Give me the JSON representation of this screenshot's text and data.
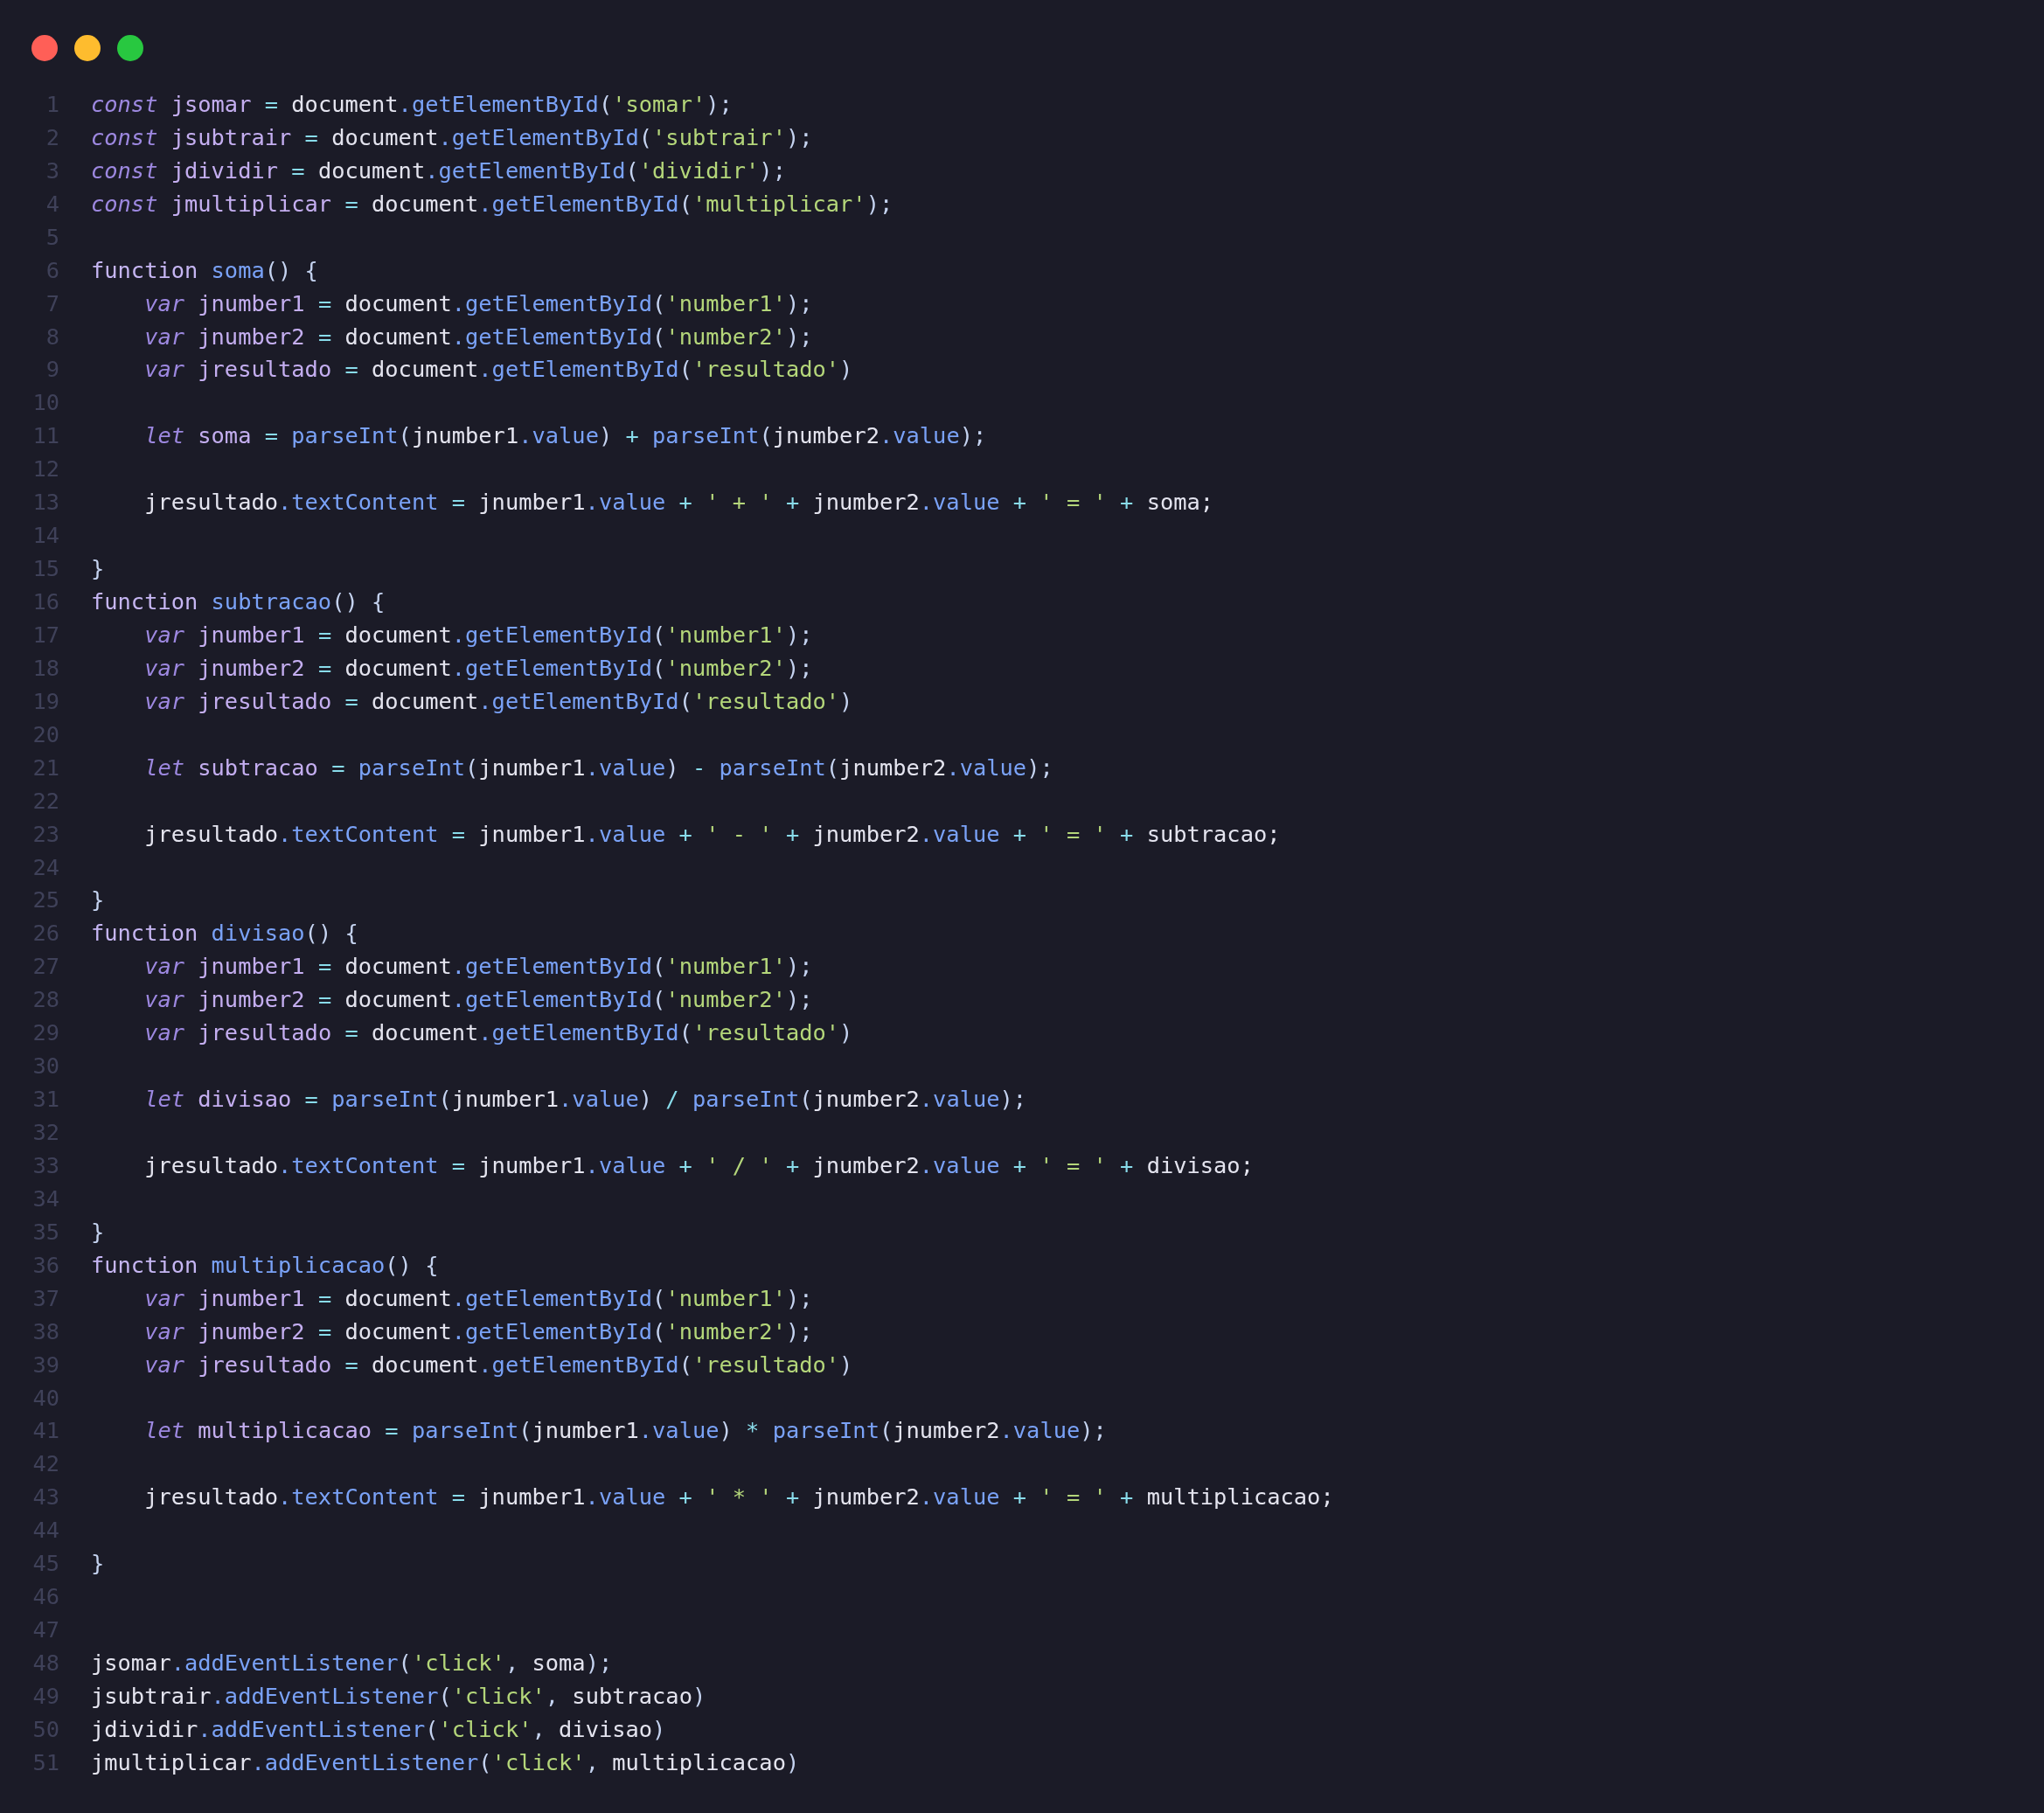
{
  "window": {
    "controls": [
      {
        "kind": "close"
      },
      {
        "kind": "minimize"
      },
      {
        "kind": "zoom"
      }
    ]
  },
  "code": {
    "lines": [
      {
        "number": "1",
        "tokens": [
          {
            "kind": "kw",
            "text": "const"
          },
          {
            "kind": "def",
            "text": " jsomar"
          },
          {
            "kind": "op",
            "text": " = "
          },
          {
            "kind": "id",
            "text": "document"
          },
          {
            "kind": "prop",
            "text": ".getElementById"
          },
          {
            "kind": "p",
            "text": "("
          },
          {
            "kind": "str",
            "text": "'somar'"
          },
          {
            "kind": "p",
            "text": ");"
          }
        ]
      },
      {
        "number": "2",
        "tokens": [
          {
            "kind": "kw",
            "text": "const"
          },
          {
            "kind": "def",
            "text": " jsubtrair"
          },
          {
            "kind": "op",
            "text": " = "
          },
          {
            "kind": "id",
            "text": "document"
          },
          {
            "kind": "prop",
            "text": ".getElementById"
          },
          {
            "kind": "p",
            "text": "("
          },
          {
            "kind": "str",
            "text": "'subtrair'"
          },
          {
            "kind": "p",
            "text": ");"
          }
        ]
      },
      {
        "number": "3",
        "tokens": [
          {
            "kind": "kw",
            "text": "const"
          },
          {
            "kind": "def",
            "text": " jdividir"
          },
          {
            "kind": "op",
            "text": " = "
          },
          {
            "kind": "id",
            "text": "document"
          },
          {
            "kind": "prop",
            "text": ".getElementById"
          },
          {
            "kind": "p",
            "text": "("
          },
          {
            "kind": "str",
            "text": "'dividir'"
          },
          {
            "kind": "p",
            "text": ");"
          }
        ]
      },
      {
        "number": "4",
        "tokens": [
          {
            "kind": "kw",
            "text": "const"
          },
          {
            "kind": "def",
            "text": " jmultiplicar"
          },
          {
            "kind": "op",
            "text": " = "
          },
          {
            "kind": "id",
            "text": "document"
          },
          {
            "kind": "prop",
            "text": ".getElementById"
          },
          {
            "kind": "p",
            "text": "("
          },
          {
            "kind": "str",
            "text": "'multiplicar'"
          },
          {
            "kind": "p",
            "text": ");"
          }
        ]
      },
      {
        "number": "5"
      },
      {
        "number": "6",
        "tokens": [
          {
            "kind": "fn",
            "text": "function"
          },
          {
            "kind": "prop",
            "text": " soma"
          },
          {
            "kind": "p",
            "text": "() {"
          }
        ]
      },
      {
        "number": "7",
        "tokens": [
          {
            "kind": "kw",
            "text": "    var"
          },
          {
            "kind": "def",
            "text": " jnumber1"
          },
          {
            "kind": "op",
            "text": " = "
          },
          {
            "kind": "id",
            "text": "document"
          },
          {
            "kind": "prop",
            "text": ".getElementById"
          },
          {
            "kind": "p",
            "text": "("
          },
          {
            "kind": "str",
            "text": "'number1'"
          },
          {
            "kind": "p",
            "text": ");"
          }
        ]
      },
      {
        "number": "8",
        "tokens": [
          {
            "kind": "kw",
            "text": "    var"
          },
          {
            "kind": "def",
            "text": " jnumber2"
          },
          {
            "kind": "op",
            "text": " = "
          },
          {
            "kind": "id",
            "text": "document"
          },
          {
            "kind": "prop",
            "text": ".getElementById"
          },
          {
            "kind": "p",
            "text": "("
          },
          {
            "kind": "str",
            "text": "'number2'"
          },
          {
            "kind": "p",
            "text": ");"
          }
        ]
      },
      {
        "number": "9",
        "tokens": [
          {
            "kind": "kw",
            "text": "    var"
          },
          {
            "kind": "def",
            "text": " jresultado"
          },
          {
            "kind": "op",
            "text": " = "
          },
          {
            "kind": "id",
            "text": "document"
          },
          {
            "kind": "prop",
            "text": ".getElementById"
          },
          {
            "kind": "p",
            "text": "("
          },
          {
            "kind": "str",
            "text": "'resultado'"
          },
          {
            "kind": "p",
            "text": ")"
          }
        ]
      },
      {
        "number": "10"
      },
      {
        "number": "11",
        "tokens": [
          {
            "kind": "kw",
            "text": "    let"
          },
          {
            "kind": "def",
            "text": " soma"
          },
          {
            "kind": "op",
            "text": " = "
          },
          {
            "kind": "prop",
            "text": "parseInt"
          },
          {
            "kind": "p",
            "text": "("
          },
          {
            "kind": "id",
            "text": "jnumber1"
          },
          {
            "kind": "prop",
            "text": ".value"
          },
          {
            "kind": "p",
            "text": ")"
          },
          {
            "kind": "op",
            "text": " + "
          },
          {
            "kind": "prop",
            "text": "parseInt"
          },
          {
            "kind": "p",
            "text": "("
          },
          {
            "kind": "id",
            "text": "jnumber2"
          },
          {
            "kind": "prop",
            "text": ".value"
          },
          {
            "kind": "p",
            "text": ");"
          }
        ]
      },
      {
        "number": "12"
      },
      {
        "number": "13",
        "tokens": [
          {
            "kind": "id",
            "text": "    jresultado"
          },
          {
            "kind": "prop",
            "text": ".textContent"
          },
          {
            "kind": "op",
            "text": " = "
          },
          {
            "kind": "id",
            "text": "jnumber1"
          },
          {
            "kind": "prop",
            "text": ".value"
          },
          {
            "kind": "op",
            "text": " + "
          },
          {
            "kind": "str",
            "text": "' + '"
          },
          {
            "kind": "op",
            "text": " + "
          },
          {
            "kind": "id",
            "text": "jnumber2"
          },
          {
            "kind": "prop",
            "text": ".value"
          },
          {
            "kind": "op",
            "text": " + "
          },
          {
            "kind": "str",
            "text": "' = '"
          },
          {
            "kind": "op",
            "text": " + "
          },
          {
            "kind": "id",
            "text": "soma;"
          }
        ]
      },
      {
        "number": "14"
      },
      {
        "number": "15",
        "tokens": [
          {
            "kind": "p",
            "text": "}"
          }
        ]
      },
      {
        "number": "16",
        "tokens": [
          {
            "kind": "fn",
            "text": "function"
          },
          {
            "kind": "prop",
            "text": " subtracao"
          },
          {
            "kind": "p",
            "text": "() {"
          }
        ]
      },
      {
        "number": "17",
        "tokens": [
          {
            "kind": "kw",
            "text": "    var"
          },
          {
            "kind": "def",
            "text": " jnumber1"
          },
          {
            "kind": "op",
            "text": " = "
          },
          {
            "kind": "id",
            "text": "document"
          },
          {
            "kind": "prop",
            "text": ".getElementById"
          },
          {
            "kind": "p",
            "text": "("
          },
          {
            "kind": "str",
            "text": "'number1'"
          },
          {
            "kind": "p",
            "text": ");"
          }
        ]
      },
      {
        "number": "18",
        "tokens": [
          {
            "kind": "kw",
            "text": "    var"
          },
          {
            "kind": "def",
            "text": " jnumber2"
          },
          {
            "kind": "op",
            "text": " = "
          },
          {
            "kind": "id",
            "text": "document"
          },
          {
            "kind": "prop",
            "text": ".getElementById"
          },
          {
            "kind": "p",
            "text": "("
          },
          {
            "kind": "str",
            "text": "'number2'"
          },
          {
            "kind": "p",
            "text": ");"
          }
        ]
      },
      {
        "number": "19",
        "tokens": [
          {
            "kind": "kw",
            "text": "    var"
          },
          {
            "kind": "def",
            "text": " jresultado"
          },
          {
            "kind": "op",
            "text": " = "
          },
          {
            "kind": "id",
            "text": "document"
          },
          {
            "kind": "prop",
            "text": ".getElementById"
          },
          {
            "kind": "p",
            "text": "("
          },
          {
            "kind": "str",
            "text": "'resultado'"
          },
          {
            "kind": "p",
            "text": ")"
          }
        ]
      },
      {
        "number": "20"
      },
      {
        "number": "21",
        "tokens": [
          {
            "kind": "kw",
            "text": "    let"
          },
          {
            "kind": "def",
            "text": " subtracao"
          },
          {
            "kind": "op",
            "text": " = "
          },
          {
            "kind": "prop",
            "text": "parseInt"
          },
          {
            "kind": "p",
            "text": "("
          },
          {
            "kind": "id",
            "text": "jnumber1"
          },
          {
            "kind": "prop",
            "text": ".value"
          },
          {
            "kind": "p",
            "text": ")"
          },
          {
            "kind": "op",
            "text": " - "
          },
          {
            "kind": "prop",
            "text": "parseInt"
          },
          {
            "kind": "p",
            "text": "("
          },
          {
            "kind": "id",
            "text": "jnumber2"
          },
          {
            "kind": "prop",
            "text": ".value"
          },
          {
            "kind": "p",
            "text": ");"
          }
        ]
      },
      {
        "number": "22"
      },
      {
        "number": "23",
        "tokens": [
          {
            "kind": "id",
            "text": "    jresultado"
          },
          {
            "kind": "prop",
            "text": ".textContent"
          },
          {
            "kind": "op",
            "text": " = "
          },
          {
            "kind": "id",
            "text": "jnumber1"
          },
          {
            "kind": "prop",
            "text": ".value"
          },
          {
            "kind": "op",
            "text": " + "
          },
          {
            "kind": "str",
            "text": "' - '"
          },
          {
            "kind": "op",
            "text": " + "
          },
          {
            "kind": "id",
            "text": "jnumber2"
          },
          {
            "kind": "prop",
            "text": ".value"
          },
          {
            "kind": "op",
            "text": " + "
          },
          {
            "kind": "str",
            "text": "' = '"
          },
          {
            "kind": "op",
            "text": " + "
          },
          {
            "kind": "id",
            "text": "subtracao;"
          }
        ]
      },
      {
        "number": "24"
      },
      {
        "number": "25",
        "tokens": [
          {
            "kind": "p",
            "text": "}"
          }
        ]
      },
      {
        "number": "26",
        "tokens": [
          {
            "kind": "fn",
            "text": "function"
          },
          {
            "kind": "prop",
            "text": " divisao"
          },
          {
            "kind": "p",
            "text": "() {"
          }
        ]
      },
      {
        "number": "27",
        "tokens": [
          {
            "kind": "kw",
            "text": "    var"
          },
          {
            "kind": "def",
            "text": " jnumber1"
          },
          {
            "kind": "op",
            "text": " = "
          },
          {
            "kind": "id",
            "text": "document"
          },
          {
            "kind": "prop",
            "text": ".getElementById"
          },
          {
            "kind": "p",
            "text": "("
          },
          {
            "kind": "str",
            "text": "'number1'"
          },
          {
            "kind": "p",
            "text": ");"
          }
        ]
      },
      {
        "number": "28",
        "tokens": [
          {
            "kind": "kw",
            "text": "    var"
          },
          {
            "kind": "def",
            "text": " jnumber2"
          },
          {
            "kind": "op",
            "text": " = "
          },
          {
            "kind": "id",
            "text": "document"
          },
          {
            "kind": "prop",
            "text": ".getElementById"
          },
          {
            "kind": "p",
            "text": "("
          },
          {
            "kind": "str",
            "text": "'number2'"
          },
          {
            "kind": "p",
            "text": ");"
          }
        ]
      },
      {
        "number": "29",
        "tokens": [
          {
            "kind": "kw",
            "text": "    var"
          },
          {
            "kind": "def",
            "text": " jresultado"
          },
          {
            "kind": "op",
            "text": " = "
          },
          {
            "kind": "id",
            "text": "document"
          },
          {
            "kind": "prop",
            "text": ".getElementById"
          },
          {
            "kind": "p",
            "text": "("
          },
          {
            "kind": "str",
            "text": "'resultado'"
          },
          {
            "kind": "p",
            "text": ")"
          }
        ]
      },
      {
        "number": "30"
      },
      {
        "number": "31",
        "tokens": [
          {
            "kind": "kw",
            "text": "    let"
          },
          {
            "kind": "def",
            "text": " divisao"
          },
          {
            "kind": "op",
            "text": " = "
          },
          {
            "kind": "prop",
            "text": "parseInt"
          },
          {
            "kind": "p",
            "text": "("
          },
          {
            "kind": "id",
            "text": "jnumber1"
          },
          {
            "kind": "prop",
            "text": ".value"
          },
          {
            "kind": "p",
            "text": ")"
          },
          {
            "kind": "op",
            "text": " / "
          },
          {
            "kind": "prop",
            "text": "parseInt"
          },
          {
            "kind": "p",
            "text": "("
          },
          {
            "kind": "id",
            "text": "jnumber2"
          },
          {
            "kind": "prop",
            "text": ".value"
          },
          {
            "kind": "p",
            "text": ");"
          }
        ]
      },
      {
        "number": "32"
      },
      {
        "number": "33",
        "tokens": [
          {
            "kind": "id",
            "text": "    jresultado"
          },
          {
            "kind": "prop",
            "text": ".textContent"
          },
          {
            "kind": "op",
            "text": " = "
          },
          {
            "kind": "id",
            "text": "jnumber1"
          },
          {
            "kind": "prop",
            "text": ".value"
          },
          {
            "kind": "op",
            "text": " + "
          },
          {
            "kind": "str",
            "text": "' / '"
          },
          {
            "kind": "op",
            "text": " + "
          },
          {
            "kind": "id",
            "text": "jnumber2"
          },
          {
            "kind": "prop",
            "text": ".value"
          },
          {
            "kind": "op",
            "text": " + "
          },
          {
            "kind": "str",
            "text": "' = '"
          },
          {
            "kind": "op",
            "text": " + "
          },
          {
            "kind": "id",
            "text": "divisao;"
          }
        ]
      },
      {
        "number": "34"
      },
      {
        "number": "35",
        "tokens": [
          {
            "kind": "p",
            "text": "}"
          }
        ]
      },
      {
        "number": "36",
        "tokens": [
          {
            "kind": "fn",
            "text": "function"
          },
          {
            "kind": "prop",
            "text": " multiplicacao"
          },
          {
            "kind": "p",
            "text": "() {"
          }
        ]
      },
      {
        "number": "37",
        "tokens": [
          {
            "kind": "kw",
            "text": "    var"
          },
          {
            "kind": "def",
            "text": " jnumber1"
          },
          {
            "kind": "op",
            "text": " = "
          },
          {
            "kind": "id",
            "text": "document"
          },
          {
            "kind": "prop",
            "text": ".getElementById"
          },
          {
            "kind": "p",
            "text": "("
          },
          {
            "kind": "str",
            "text": "'number1'"
          },
          {
            "kind": "p",
            "text": ");"
          }
        ]
      },
      {
        "number": "38",
        "tokens": [
          {
            "kind": "kw",
            "text": "    var"
          },
          {
            "kind": "def",
            "text": " jnumber2"
          },
          {
            "kind": "op",
            "text": " = "
          },
          {
            "kind": "id",
            "text": "document"
          },
          {
            "kind": "prop",
            "text": ".getElementById"
          },
          {
            "kind": "p",
            "text": "("
          },
          {
            "kind": "str",
            "text": "'number2'"
          },
          {
            "kind": "p",
            "text": ");"
          }
        ]
      },
      {
        "number": "39",
        "tokens": [
          {
            "kind": "kw",
            "text": "    var"
          },
          {
            "kind": "def",
            "text": " jresultado"
          },
          {
            "kind": "op",
            "text": " = "
          },
          {
            "kind": "id",
            "text": "document"
          },
          {
            "kind": "prop",
            "text": ".getElementById"
          },
          {
            "kind": "p",
            "text": "("
          },
          {
            "kind": "str",
            "text": "'resultado'"
          },
          {
            "kind": "p",
            "text": ")"
          }
        ]
      },
      {
        "number": "40"
      },
      {
        "number": "41",
        "tokens": [
          {
            "kind": "kw",
            "text": "    let"
          },
          {
            "kind": "def",
            "text": " multiplicacao"
          },
          {
            "kind": "op",
            "text": " = "
          },
          {
            "kind": "prop",
            "text": "parseInt"
          },
          {
            "kind": "p",
            "text": "("
          },
          {
            "kind": "id",
            "text": "jnumber1"
          },
          {
            "kind": "prop",
            "text": ".value"
          },
          {
            "kind": "p",
            "text": ")"
          },
          {
            "kind": "op",
            "text": " * "
          },
          {
            "kind": "prop",
            "text": "parseInt"
          },
          {
            "kind": "p",
            "text": "("
          },
          {
            "kind": "id",
            "text": "jnumber2"
          },
          {
            "kind": "prop",
            "text": ".value"
          },
          {
            "kind": "p",
            "text": ");"
          }
        ]
      },
      {
        "number": "42"
      },
      {
        "number": "43",
        "tokens": [
          {
            "kind": "id",
            "text": "    jresultado"
          },
          {
            "kind": "prop",
            "text": ".textContent"
          },
          {
            "kind": "op",
            "text": " = "
          },
          {
            "kind": "id",
            "text": "jnumber1"
          },
          {
            "kind": "prop",
            "text": ".value"
          },
          {
            "kind": "op",
            "text": " + "
          },
          {
            "kind": "str",
            "text": "' * '"
          },
          {
            "kind": "op",
            "text": " + "
          },
          {
            "kind": "id",
            "text": "jnumber2"
          },
          {
            "kind": "prop",
            "text": ".value"
          },
          {
            "kind": "op",
            "text": " + "
          },
          {
            "kind": "str",
            "text": "' = '"
          },
          {
            "kind": "op",
            "text": " + "
          },
          {
            "kind": "id",
            "text": "multiplicacao;"
          }
        ]
      },
      {
        "number": "44"
      },
      {
        "number": "45",
        "tokens": [
          {
            "kind": "p",
            "text": "}"
          }
        ]
      },
      {
        "number": "46"
      },
      {
        "number": "47"
      },
      {
        "number": "48",
        "tokens": [
          {
            "kind": "id",
            "text": "jsomar"
          },
          {
            "kind": "prop",
            "text": ".addEventListener"
          },
          {
            "kind": "p",
            "text": "("
          },
          {
            "kind": "str",
            "text": "'click'"
          },
          {
            "kind": "p",
            "text": ", "
          },
          {
            "kind": "id",
            "text": "soma"
          },
          {
            "kind": "p",
            "text": ");"
          }
        ]
      },
      {
        "number": "49",
        "tokens": [
          {
            "kind": "id",
            "text": "jsubtrair"
          },
          {
            "kind": "prop",
            "text": ".addEventListener"
          },
          {
            "kind": "p",
            "text": "("
          },
          {
            "kind": "str",
            "text": "'click'"
          },
          {
            "kind": "p",
            "text": ", "
          },
          {
            "kind": "id",
            "text": "subtracao"
          },
          {
            "kind": "p",
            "text": ")"
          }
        ]
      },
      {
        "number": "50",
        "tokens": [
          {
            "kind": "id",
            "text": "jdividir"
          },
          {
            "kind": "prop",
            "text": ".addEventListener"
          },
          {
            "kind": "p",
            "text": "("
          },
          {
            "kind": "str",
            "text": "'click'"
          },
          {
            "kind": "p",
            "text": ", "
          },
          {
            "kind": "id",
            "text": "divisao"
          },
          {
            "kind": "p",
            "text": ")"
          }
        ]
      },
      {
        "number": "51",
        "tokens": [
          {
            "kind": "id",
            "text": "jmultiplicar"
          },
          {
            "kind": "prop",
            "text": ".addEventListener"
          },
          {
            "kind": "p",
            "text": "("
          },
          {
            "kind": "str",
            "text": "'click'"
          },
          {
            "kind": "p",
            "text": ", "
          },
          {
            "kind": "id",
            "text": "multiplicacao"
          },
          {
            "kind": "p",
            "text": ")"
          }
        ]
      }
    ]
  }
}
